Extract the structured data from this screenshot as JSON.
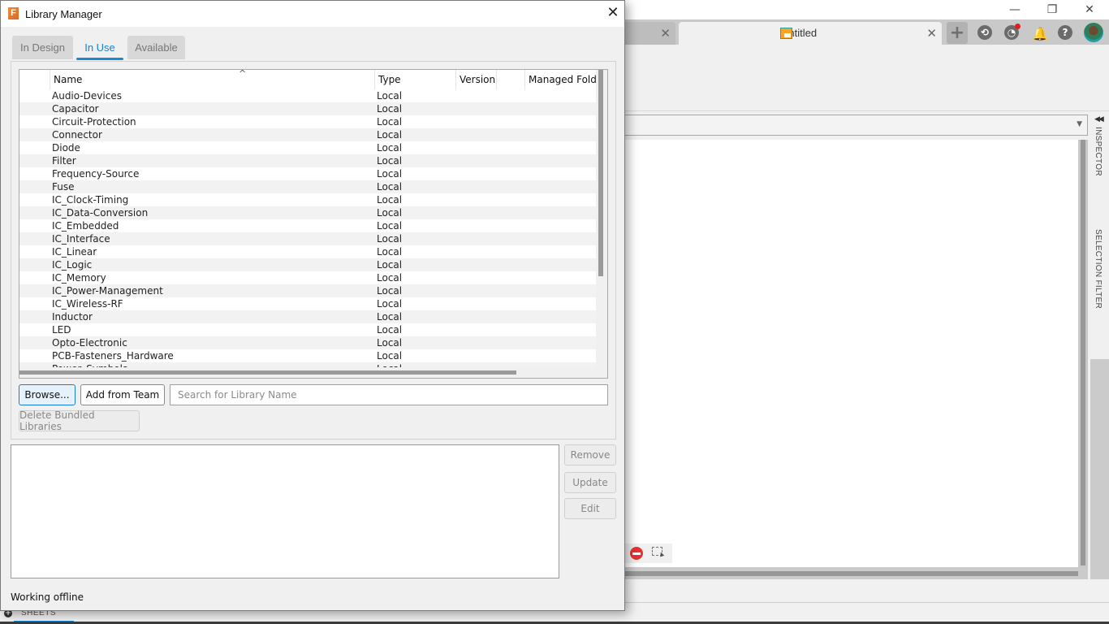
{
  "app": {
    "window_controls": {
      "minimize": "—",
      "maximize": "❐",
      "close": "✕"
    },
    "tabs": [
      {
        "title": "",
        "close": "✕"
      },
      {
        "title": "Untitled",
        "close": "✕",
        "active": true
      }
    ],
    "toolbar_icons": [
      "new-tab-plus",
      "extensions",
      "job-status",
      "notifications",
      "help",
      "profile-avatar"
    ],
    "new_tab_label": "+",
    "help_label": "?",
    "bell_label": "🔔",
    "job_status_alert_color": "#e02020",
    "side_panels": {
      "inspector": "INSPECTOR",
      "selection_filter": "SELECTION FILTER",
      "collapse": "◀◀"
    },
    "combo_arrow": "▼",
    "sheets_label": "SHEETS",
    "sheets_plus": "+"
  },
  "dialog": {
    "title": "Library Manager",
    "logo_letter": "F",
    "close_label": "✕",
    "tabs": [
      {
        "label": "In Design",
        "active": false
      },
      {
        "label": "In Use",
        "active": true
      },
      {
        "label": "Available",
        "active": false
      }
    ],
    "accent_color": "#1a7fd4",
    "table": {
      "sort_indicator": "^",
      "columns": [
        "",
        "Name",
        "Type",
        "Version",
        "",
        "Managed Folde"
      ],
      "rows": [
        {
          "name": "Audio-Devices",
          "type": "Local"
        },
        {
          "name": "Capacitor",
          "type": "Local"
        },
        {
          "name": "Circuit-Protection",
          "type": "Local"
        },
        {
          "name": "Connector",
          "type": "Local"
        },
        {
          "name": "Diode",
          "type": "Local"
        },
        {
          "name": "Filter",
          "type": "Local"
        },
        {
          "name": "Frequency-Source",
          "type": "Local"
        },
        {
          "name": "Fuse",
          "type": "Local"
        },
        {
          "name": "IC_Clock-Timing",
          "type": "Local"
        },
        {
          "name": "IC_Data-Conversion",
          "type": "Local"
        },
        {
          "name": "IC_Embedded",
          "type": "Local"
        },
        {
          "name": "IC_Interface",
          "type": "Local"
        },
        {
          "name": "IC_Linear",
          "type": "Local"
        },
        {
          "name": "IC_Logic",
          "type": "Local"
        },
        {
          "name": "IC_Memory",
          "type": "Local"
        },
        {
          "name": "IC_Power-Management",
          "type": "Local"
        },
        {
          "name": "IC_Wireless-RF",
          "type": "Local"
        },
        {
          "name": "Inductor",
          "type": "Local"
        },
        {
          "name": "LED",
          "type": "Local"
        },
        {
          "name": "Opto-Electronic",
          "type": "Local"
        },
        {
          "name": "PCB-Fasteners_Hardware",
          "type": "Local"
        },
        {
          "name": "Power_Symbols",
          "type": "Local"
        }
      ]
    },
    "buttons": {
      "browse": "Browse...",
      "add_from_team": "Add from Team",
      "delete_bundled": "Delete Bundled Libraries",
      "remove": "Remove",
      "update": "Update",
      "edit": "Edit"
    },
    "search": {
      "value": "",
      "placeholder": "Search for Library Name"
    },
    "status": "Working offline"
  }
}
